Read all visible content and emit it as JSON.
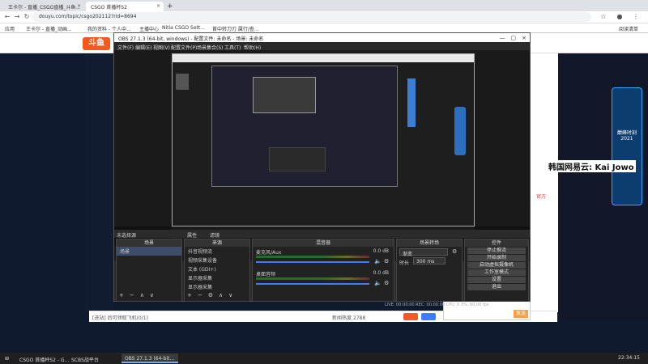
{
  "browser": {
    "tabs": [
      {
        "label": "王卡尔 - 直播_CSGO直播_斗鱼..."
      },
      {
        "label": "CSGO 首播杯S2"
      }
    ],
    "url": "douyu.com/topic/csgo202112?rid=8694",
    "bookmarks": [
      "应用",
      "王卡尔 - 直播_动画...",
      "我的资料 - 个人中...",
      "主播中心",
      "Nitia CSGO Sett...",
      "首中转刀刃 属行/查..."
    ],
    "reading_list": "阅读清单"
  },
  "site": {
    "logo_text": "斗鱼",
    "chat_placeholder": "[进站] 后可领取飞机(0/1)",
    "send_label": "发送",
    "stats": "新闻热度 2788",
    "side_label": "官方",
    "promo": "巅峰时刻 2021"
  },
  "overlay_text": "韩国网易云: Kai Jowo",
  "obs": {
    "title": "OBS 27.1.3 (64-bit, windows) - 配置文件: 未命名 - 场景: 未命名",
    "menu": [
      "文件(F)",
      "编辑(E)",
      "视图(V)",
      "配置文件(P)",
      "场景集合(S)",
      "工具(T)",
      "帮助(H)"
    ],
    "status_left": "未选择源",
    "props_label": "属性",
    "filters_label": "滤镜",
    "docks": {
      "scenes": {
        "title": "场景",
        "items": [
          "场景"
        ]
      },
      "sources": {
        "title": "来源",
        "items": [
          "抖音视频流",
          "视频采集设备",
          "文本 (GDI+)",
          "显示器采集",
          "显示器采集"
        ]
      },
      "mixer": {
        "title": "混音器",
        "tracks": [
          "麦克风/Aux",
          "桌面音频"
        ],
        "db": [
          "0.0 dB",
          "0.0 dB"
        ]
      },
      "transitions": {
        "title": "场景转场",
        "type": "渐变",
        "duration_label": "时长",
        "duration": "300 ms"
      },
      "controls": {
        "title": "控件",
        "buttons": [
          "停止推流",
          "开始录制",
          "启动虚拟摄像机",
          "工作室模式",
          "设置",
          "退出"
        ]
      }
    },
    "footer": "LIVE: 00:00:00   REC: 00:00:00   CPU: 0.3%, 60.00 fps"
  },
  "taskbar": {
    "items": [
      "CSGO 首播杯S2 - G...",
      "SCBS战平台",
      "OBS 27.1.3 (64-bit..."
    ],
    "clock": "22:34:15"
  }
}
